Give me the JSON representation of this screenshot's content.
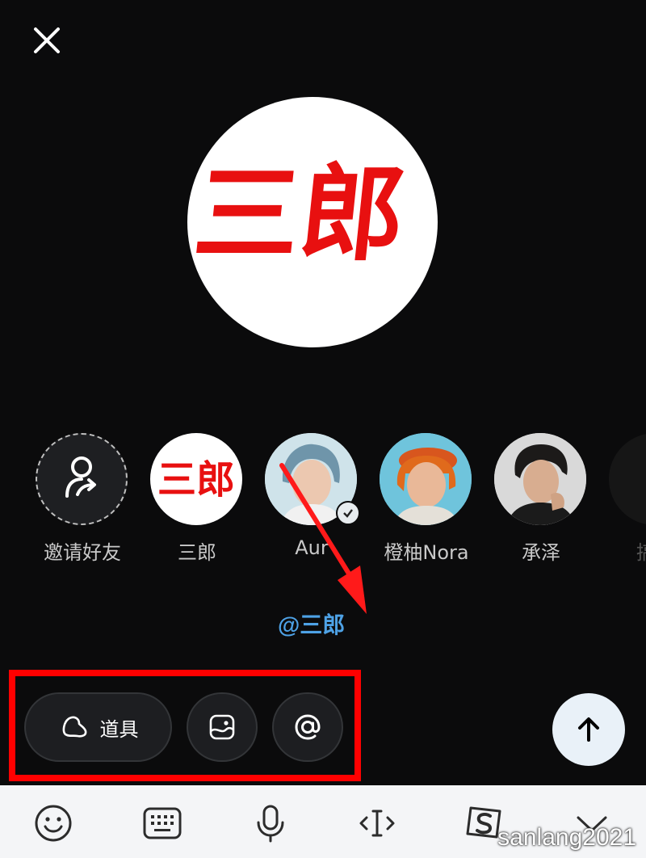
{
  "close": {
    "icon": "close-icon"
  },
  "avatar": {
    "text": "三郎",
    "color": "#e81010"
  },
  "friends": [
    {
      "name": "邀请好友",
      "kind": "invite",
      "icon": "add-friend-icon"
    },
    {
      "name": "三郎",
      "kind": "text-logo"
    },
    {
      "name": "Aur",
      "kind": "photo",
      "verified": true
    },
    {
      "name": "橙柚Nora",
      "kind": "photo"
    },
    {
      "name": "承泽",
      "kind": "photo"
    },
    {
      "name": "搞笑",
      "kind": "partial"
    }
  ],
  "mention_annotation": "@三郎",
  "toolbar": {
    "props_label": "道具",
    "props_icon": "hat-icon",
    "image_icon": "image-icon",
    "mention_icon": "at-icon"
  },
  "send": {
    "icon": "arrow-up-icon"
  },
  "keyboard_bar": {
    "icons": [
      "emoji-icon",
      "keyboard-icon",
      "microphone-icon",
      "cursor-icon",
      "sogou-icon",
      "collapse-icon"
    ]
  },
  "watermark": "sanlang2021",
  "colors": {
    "background": "#0b0b0c",
    "highlight": "#ff0000",
    "mention": "#4ea2e6",
    "send_bg": "#e9f1f8"
  }
}
